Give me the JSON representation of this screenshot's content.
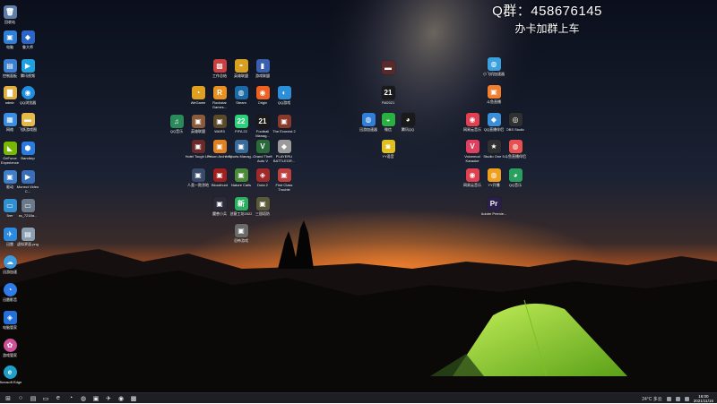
{
  "overlay": {
    "qq_text": "Q群：458676145",
    "subtitle": "办卡加群上车"
  },
  "colors": {
    "sky_top": "#0d1220",
    "horizon_glow": "#e1662a",
    "tent": "#9be02c",
    "taskbar": "#1e1f24"
  },
  "desktop_icons": [
    {
      "name": "recycle-bin",
      "label": "回收站",
      "glyph": "🗑",
      "color": "#5c7ea8",
      "round": false
    },
    {
      "name": "computer",
      "label": "电脑",
      "glyph": "▣",
      "color": "#2f7fd8",
      "round": false
    },
    {
      "name": "app-blue",
      "label": "鲁大师",
      "glyph": "◆",
      "color": "#2a66c7",
      "round": false
    },
    {
      "name": "control-panel",
      "label": "控制面板",
      "glyph": "▤",
      "color": "#3a7fd1",
      "round": false
    },
    {
      "name": "app-play",
      "label": "腾讯视频",
      "glyph": "▶",
      "color": "#20a0e0",
      "round": false
    },
    {
      "name": "admin",
      "label": "admin",
      "glyph": "▇",
      "color": "#e0b040",
      "round": false
    },
    {
      "name": "qq-browser",
      "label": "QQ浏览器",
      "glyph": "◉",
      "color": "#1e8fe0",
      "round": true
    },
    {
      "name": "network",
      "label": "网络",
      "glyph": "▦",
      "color": "#3a8de0",
      "round": false
    },
    {
      "name": "folder",
      "label": "飞跃游戏图",
      "glyph": "▬",
      "color": "#e7b84a",
      "round": false
    },
    {
      "name": "geforce",
      "label": "GeForce Experience",
      "glyph": "◣",
      "color": "#76b900",
      "round": false
    },
    {
      "name": "bandizip",
      "label": "Bandizip",
      "glyph": "⬢",
      "color": "#2a7be0",
      "round": false
    },
    {
      "name": "app-box",
      "label": "驱动",
      "glyph": "▣",
      "color": "#3f7fc8",
      "round": false
    },
    {
      "name": "monect",
      "label": "Monect Video C...",
      "glyph": "▶",
      "color": "#3a6fb8",
      "round": false
    },
    {
      "name": "app-5",
      "label": "5rer",
      "glyph": "▭",
      "color": "#2f8fd0",
      "round": false
    },
    {
      "name": "file-1",
      "label": "ss_7218a...",
      "glyph": "▭",
      "color": "#6a7a8a",
      "round": false
    },
    {
      "name": "app-bird",
      "label": "迅雷",
      "glyph": "✈",
      "color": "#2a8ae0",
      "round": false
    },
    {
      "name": "app-img",
      "label": "虚拟界面.png",
      "glyph": "▤",
      "color": "#8aa0b0",
      "round": false
    },
    {
      "name": "app-cloud",
      "label": "迅游加速",
      "glyph": "☁",
      "color": "#3d9be0",
      "round": true
    },
    {
      "name": "app-chat",
      "label": "迅雷影音",
      "glyph": "◔",
      "color": "#2f7be8",
      "round": true
    },
    {
      "name": "app-shield",
      "label": "电脑管家",
      "glyph": "◈",
      "color": "#2270d8",
      "round": false
    },
    {
      "name": "app-color",
      "label": "游戏管家",
      "glyph": "✿",
      "color": "#d0509a",
      "round": true
    },
    {
      "name": "edge",
      "label": "Microsoft Edge",
      "glyph": "e",
      "color": "#1da1c8",
      "round": true
    }
  ],
  "center_icons": [
    {
      "name": "app-c1",
      "label": "工作总结",
      "glyph": "▩",
      "color": "#c84040"
    },
    {
      "name": "app-c2",
      "label": "英雄联盟",
      "glyph": "◓",
      "color": "#d9a020"
    },
    {
      "name": "app-c3",
      "label": "游戏联盟",
      "glyph": "▮",
      "color": "#3a5fb0"
    },
    {
      "name": "wegame",
      "label": "WeGame",
      "glyph": "◔",
      "color": "#e0a020"
    },
    {
      "name": "rockstar",
      "label": "Rockstar Games...",
      "glyph": "R",
      "color": "#e89020"
    },
    {
      "name": "steam",
      "label": "Steam",
      "glyph": "◍",
      "color": "#1b6aa8"
    },
    {
      "name": "origin",
      "label": "Origin",
      "glyph": "◉",
      "color": "#f06020"
    },
    {
      "name": "qq-game",
      "label": "QQ游戏",
      "glyph": "◐",
      "color": "#2a8fd8"
    },
    {
      "name": "music",
      "label": "QQ音乐",
      "glyph": "♫",
      "color": "#2a8a5a"
    },
    {
      "name": "app-hero",
      "label": "英雄联盟",
      "glyph": "▣",
      "color": "#8a5a3a"
    },
    {
      "name": "war3",
      "label": "WAR3",
      "glyph": "▣",
      "color": "#5a4a2a"
    },
    {
      "name": "fifa",
      "label": "FIFA 22",
      "glyph": "22",
      "color": "#2ad07a"
    },
    {
      "name": "football",
      "label": "Football Manag...",
      "glyph": "21",
      "color": "#1a1a1a"
    },
    {
      "name": "exorcist",
      "label": "The Exorcist 2",
      "glyph": "▣",
      "color": "#8a3a2a"
    },
    {
      "name": "hotel",
      "label": "Hotel Tough Life",
      "glyph": "▣",
      "color": "#6a2a2a"
    },
    {
      "name": "prison",
      "label": "Prison Architect",
      "glyph": "▣",
      "color": "#e08020"
    },
    {
      "name": "sports",
      "label": "Sports Manag...",
      "glyph": "▣",
      "color": "#3a6a9a"
    },
    {
      "name": "gta",
      "label": "Grand Theft Auto V",
      "glyph": "V",
      "color": "#2a6a3a"
    },
    {
      "name": "pubg",
      "label": "PLAYERU BATTLEGR...",
      "glyph": "◆",
      "color": "#9a9a9a"
    },
    {
      "name": "app-ox",
      "label": "人类一败涂地",
      "glyph": "▣",
      "color": "#3a4a6a"
    },
    {
      "name": "bloodhunt",
      "label": "Bloodhunt",
      "glyph": "▣",
      "color": "#a02020"
    },
    {
      "name": "nature",
      "label": "Nature Calls",
      "glyph": "▣",
      "color": "#4a8a3a"
    },
    {
      "name": "dota",
      "label": "Dota 2",
      "glyph": "◈",
      "color": "#a02a2a"
    },
    {
      "name": "first-class",
      "label": "First Class Trouble",
      "glyph": "▣",
      "color": "#c04040"
    },
    {
      "name": "app-flag",
      "label": "魔兽小兵",
      "glyph": "▣",
      "color": "#2a2a3a"
    },
    {
      "name": "app-new",
      "label": "创意工坊2022",
      "glyph": "新",
      "color": "#2ab060"
    },
    {
      "name": "app-tower",
      "label": "三国塔防",
      "glyph": "▣",
      "color": "#5a5a3a"
    },
    {
      "name": "app-cabin",
      "label": "恐怖游戏",
      "glyph": "▣",
      "color": "#6a6a6a"
    }
  ],
  "mid_icons": [
    {
      "name": "app-m1",
      "label": "",
      "glyph": "▬",
      "color": "#5a2a2a"
    },
    {
      "name": "app-m2",
      "label": "FM2021",
      "glyph": "21",
      "color": "#1a1a1a"
    },
    {
      "name": "app-m3",
      "label": "迅游加速器",
      "glyph": "◍",
      "color": "#2f7fd8"
    },
    {
      "name": "wechat",
      "label": "微信",
      "glyph": "◒",
      "color": "#2ab040"
    },
    {
      "name": "qq",
      "label": "腾讯QQ",
      "glyph": "◕",
      "color": "#1a1a1a"
    },
    {
      "name": "app-m4",
      "label": "YY语音",
      "glyph": "◙",
      "color": "#e0c020"
    }
  ],
  "right_icons": [
    {
      "name": "app-r1",
      "label": "小飞机加速器",
      "glyph": "◍",
      "color": "#3aa0e0"
    },
    {
      "name": "app-r2",
      "label": "斗鱼直播",
      "glyph": "▣",
      "color": "#f08030"
    },
    {
      "name": "app-r3",
      "label": "网易云音乐",
      "glyph": "◉",
      "color": "#e04050"
    },
    {
      "name": "app-r4",
      "label": "QQ直播伴侣",
      "glyph": "◆",
      "color": "#3a8fd8"
    },
    {
      "name": "obs",
      "label": "OBS Studio",
      "glyph": "◎",
      "color": "#303030"
    },
    {
      "name": "voicemod",
      "label": "Voicemod Karaoke",
      "glyph": "V",
      "color": "#e04060"
    },
    {
      "name": "studio-one",
      "label": "Studio One 5",
      "glyph": "★",
      "color": "#303030"
    },
    {
      "name": "app-r5",
      "label": "斗鱼直播伴侣",
      "glyph": "◍",
      "color": "#e85050"
    },
    {
      "name": "app-r6",
      "label": "网易云音乐",
      "glyph": "◉",
      "color": "#e04050"
    },
    {
      "name": "app-r7",
      "label": "YY开播",
      "glyph": "◍",
      "color": "#f0a020"
    },
    {
      "name": "app-r8",
      "label": "QQ音乐",
      "glyph": "◕",
      "color": "#2aa060"
    },
    {
      "name": "premiere",
      "label": "Adobe Premie...",
      "glyph": "Pr",
      "color": "#2a1f4a"
    }
  ],
  "taskbar": {
    "items": [
      {
        "name": "start-icon",
        "glyph": "⊞"
      },
      {
        "name": "search-icon",
        "glyph": "○"
      },
      {
        "name": "task-view-icon",
        "glyph": "▤"
      },
      {
        "name": "file-explorer-icon",
        "glyph": "▭"
      },
      {
        "name": "edge-icon",
        "glyph": "e"
      },
      {
        "name": "app-taskbar-1",
        "glyph": "◔"
      },
      {
        "name": "app-taskbar-2",
        "glyph": "◍"
      },
      {
        "name": "app-taskbar-3",
        "glyph": "▣"
      },
      {
        "name": "app-taskbar-4",
        "glyph": "✈"
      },
      {
        "name": "app-taskbar-5",
        "glyph": "◉"
      },
      {
        "name": "app-taskbar-6",
        "glyph": "▩"
      }
    ],
    "weather": "24°C 多云",
    "time": "16:00",
    "date": "2021/11/16"
  }
}
